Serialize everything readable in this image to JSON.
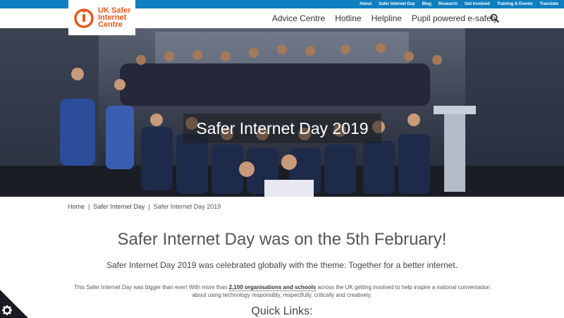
{
  "topbar": {
    "links": [
      "About",
      "Safer Internet Day",
      "Blog",
      "Research",
      "Get Involved",
      "Training & Events",
      "Translate"
    ]
  },
  "logo": {
    "line1": "UK Safer",
    "line2": "Internet",
    "line3": "Centre"
  },
  "nav": {
    "items": [
      "Advice Centre",
      "Hotline",
      "Helpline",
      "Pupil powered e-safety"
    ]
  },
  "hero": {
    "title": "Safer Internet Day 2019"
  },
  "breadcrumb": {
    "home": "Home",
    "sep": "|",
    "parent": "Safer Internet Day",
    "current": "Safer Internet Day 2019"
  },
  "main": {
    "heading": "Safer Internet Day was on the 5th February!",
    "subtitle": "Safer Internet Day 2019 was celebrated globally with the theme: Together for a better internet.",
    "para_before": "This Safer Internet Day was bigger than ever! With more than ",
    "para_link": "2,100 organisations and schools",
    "para_after": " across the UK getting involved to help inspire a national conversation about using technology responsibly, respectfully, critically and creatively.",
    "quick_links": "Quick Links:"
  },
  "colors": {
    "topbar": "#0e7fc1",
    "brand": "#e8591a"
  }
}
